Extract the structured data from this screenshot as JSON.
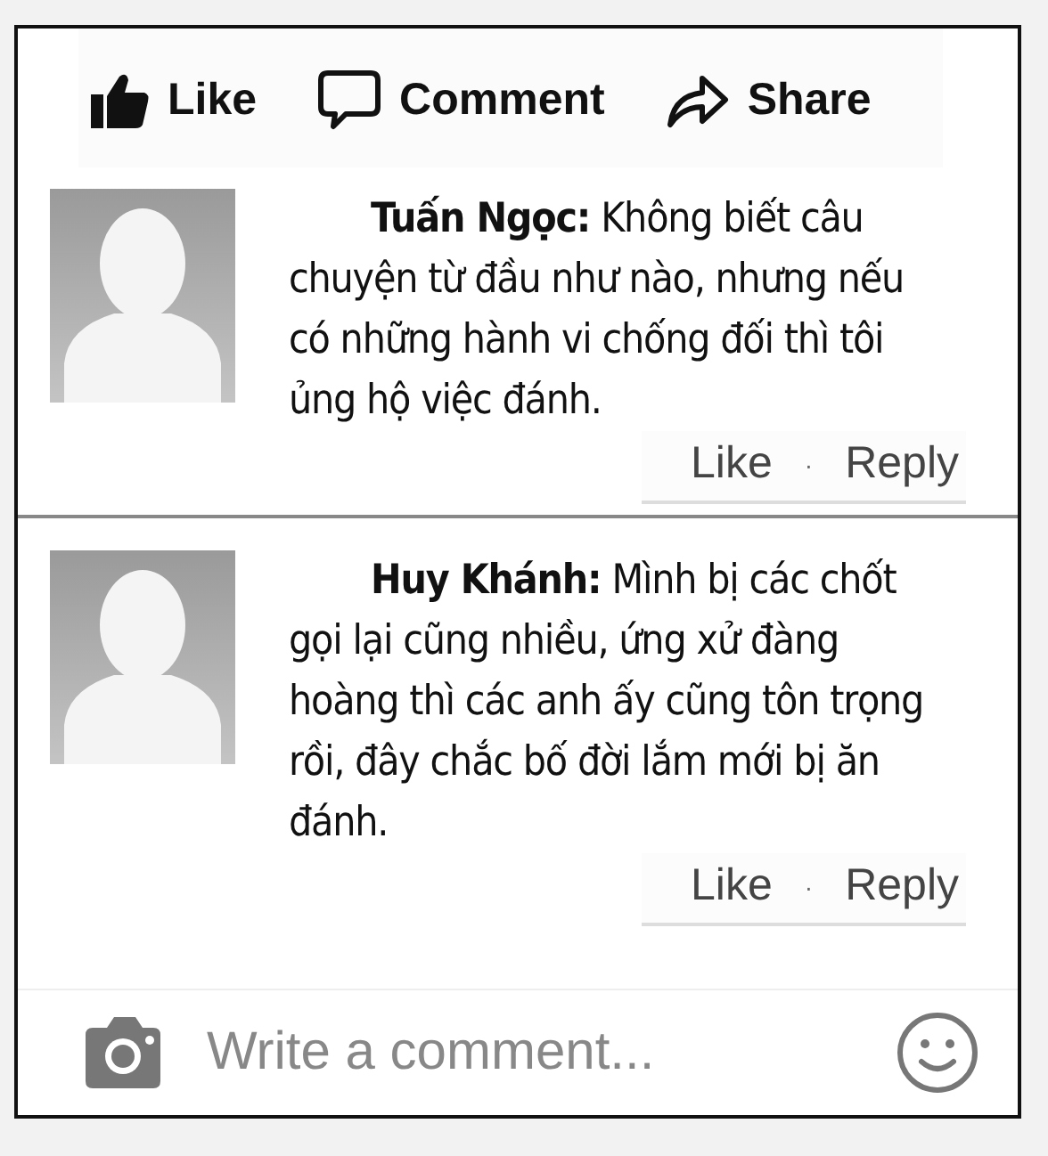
{
  "actions": [
    {
      "kind": "like",
      "label": "Like"
    },
    {
      "kind": "comment",
      "label": "Comment"
    },
    {
      "kind": "share",
      "label": "Share"
    }
  ],
  "comments": [
    {
      "text": "**Tuấn Ngọc:** Không biết câu chuyện từ đầu như nào, nhưng nếu có những hành vi chống đối thì tôi ủng hộ việc đánh.",
      "like": "Like",
      "separator": "·",
      "reply": "Reply"
    },
    {
      "text": "**Huy Khánh:** Mình bị các chốt gọi lại cũng nhiều, ứng xử đàng hoàng thì các anh ấy cũng tôn trọng rồi, đây chắc bố đời lắm mới bị ăn đánh.",
      "like": "Like",
      "separator": "·",
      "reply": "Reply"
    }
  ],
  "composer": {
    "placeholder": "Write a comment..."
  }
}
